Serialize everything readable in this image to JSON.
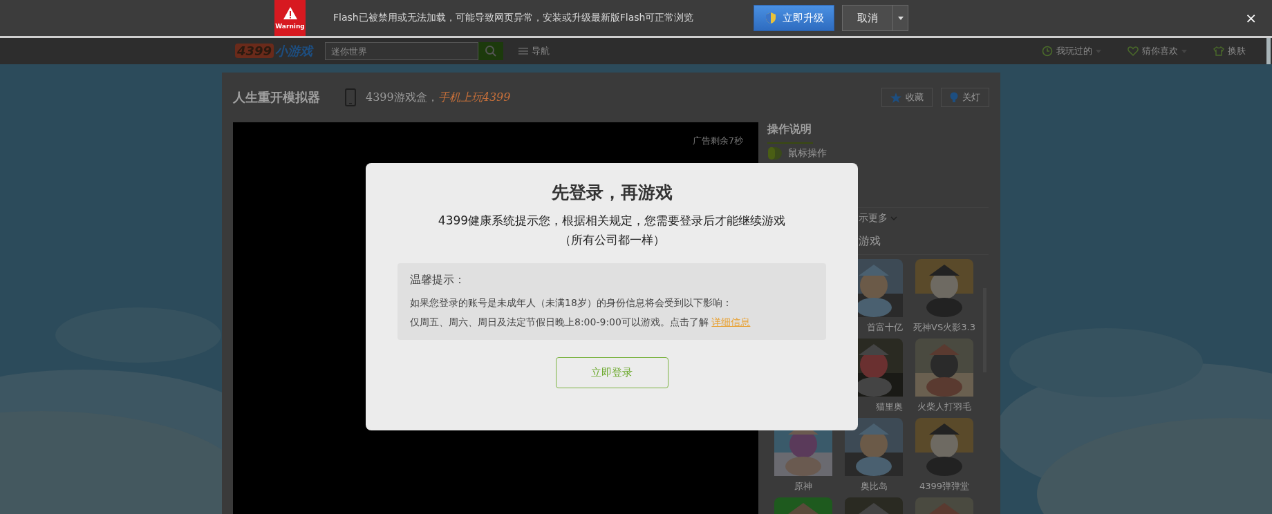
{
  "flash_bar": {
    "warning_label": "Warning",
    "message": "Flash已被禁用或无法加载，可能导致网页异常，安装或升级最新版Flash可正常浏览",
    "upgrade_button": "立即升级",
    "cancel_button": "取消",
    "close": "×"
  },
  "nav": {
    "logo_number": "4399",
    "logo_text": "小游戏",
    "search": {
      "placeholder": "迷你世界"
    },
    "menu": "导航",
    "links": [
      {
        "label": "我玩过的",
        "kind": "history"
      },
      {
        "label": "猜你喜欢",
        "kind": "favorite"
      },
      {
        "label": "换肤",
        "kind": "skin"
      }
    ]
  },
  "game": {
    "title": "人生重开模拟器",
    "promo_prefix": "4399游戏盒，",
    "promo_highlight": "手机上玩4399",
    "actions": [
      {
        "label": "收藏",
        "kind": "star"
      },
      {
        "label": "关灯",
        "kind": "bulb"
      }
    ],
    "ad_countdown": "广告剩余7秒"
  },
  "sidebar": {
    "heading": "操作说明",
    "control": "鼠标操作",
    "more": "示更多",
    "section": "游戏",
    "games": [
      [
        {
          "label": "首富十亿"
        },
        {
          "label": "死神VS火影3.3"
        }
      ],
      [
        {
          "label": "猫里奥"
        },
        {
          "label": "火柴人打羽毛"
        }
      ],
      [
        {
          "label": "原神"
        },
        {
          "label": "奥比岛"
        },
        {
          "label": "4399弹弹堂"
        }
      ],
      [
        {
          "kind": "picture"
        },
        {
          "kind": "picture"
        },
        {
          "kind": "picture"
        }
      ]
    ]
  },
  "dialog": {
    "title": "先登录，再游戏",
    "message": "4399健康系统提示您，根据相关规定，您需要登录后才能继续游戏",
    "note": "（所有公司都一样）",
    "tip_heading": "温馨提示：",
    "tip_line_1": "如果您登录的账号是未成年人（未满18岁）的身份信息将会受到以下影响：",
    "tip_line_2": "仅周五、周六、周日及法定节假日晚上8:00-9:00可以游戏。点击了解",
    "tip_link": "详细信息",
    "login_button": "立即登录"
  }
}
